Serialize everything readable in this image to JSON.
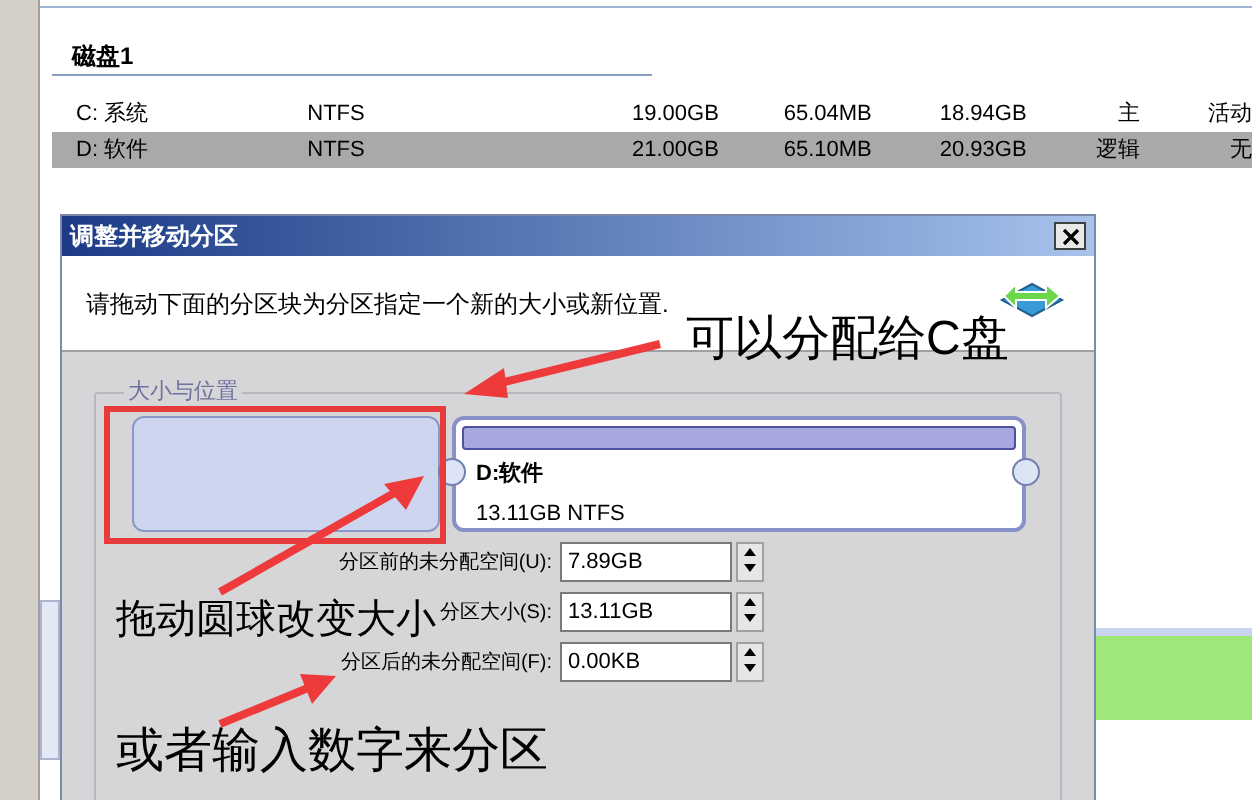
{
  "disk": {
    "title": "磁盘1",
    "partitions": [
      {
        "cells": [
          "C: 系统",
          "NTFS",
          "19.00GB",
          "65.04MB",
          "18.94GB",
          "主",
          "活动"
        ],
        "selected": false
      },
      {
        "cells": [
          "D: 软件",
          "NTFS",
          "21.00GB",
          "65.10MB",
          "20.93GB",
          "逻辑",
          "无"
        ],
        "selected": true
      }
    ]
  },
  "dialog": {
    "title": "调整并移动分区",
    "instruction": "请拖动下面的分区块为分区指定一个新的大小或新位置.",
    "group_label": "大小与位置",
    "partition": {
      "name": "D:软件",
      "detail": "13.11GB NTFS"
    },
    "fields": [
      {
        "label": "分区前的未分配空间(U):",
        "value": "7.89GB"
      },
      {
        "label": "分区大小(S):",
        "value": "13.11GB"
      },
      {
        "label": "分区后的未分配空间(F):",
        "value": "0.00KB"
      }
    ]
  },
  "annotations": [
    "可以分配给C盘",
    "拖动圆球改变大小",
    "或者输入数字来分区"
  ]
}
